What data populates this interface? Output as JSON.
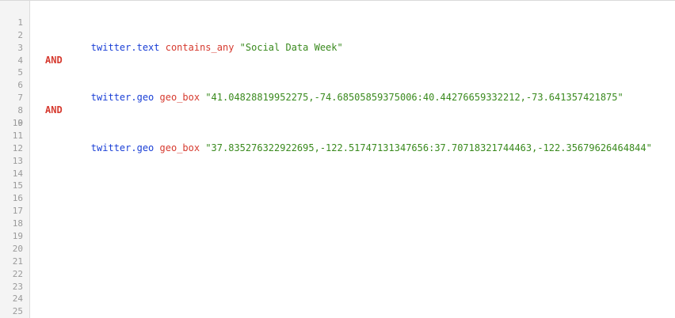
{
  "editor": {
    "line_numbers": [
      "1",
      "2",
      "3",
      "4",
      "5",
      "6",
      "7",
      "8",
      "9",
      "10",
      "11",
      "12",
      "13",
      "14",
      "15",
      "16",
      "17",
      "18",
      "19",
      "20",
      "21",
      "22",
      "23",
      "24",
      "25"
    ],
    "line1": {
      "field": "twitter.text",
      "op": "contains_any",
      "value": "\"Social Data Week\""
    },
    "line3": {
      "keyword": "AND"
    },
    "line5": {
      "field": "twitter.geo",
      "op": "geo_box",
      "value": "\"41.04828819952275,-74.68505859375006:40.44276659332212,-73.641357421875\""
    },
    "line7": {
      "keyword": "AND"
    },
    "line9": {
      "field": "twitter.geo",
      "op": "geo_box",
      "value": "\"37.835276322922695,-122.51747131347656:37.70718321744463,-122.35679626464844\""
    }
  },
  "colors": {
    "field": "#1a3fd6",
    "operator": "#d63a2f",
    "string": "#3a8a1e",
    "keyword": "#d63a2f",
    "gutter_bg": "#f4f4f4",
    "line_number": "#9a9a9a"
  }
}
